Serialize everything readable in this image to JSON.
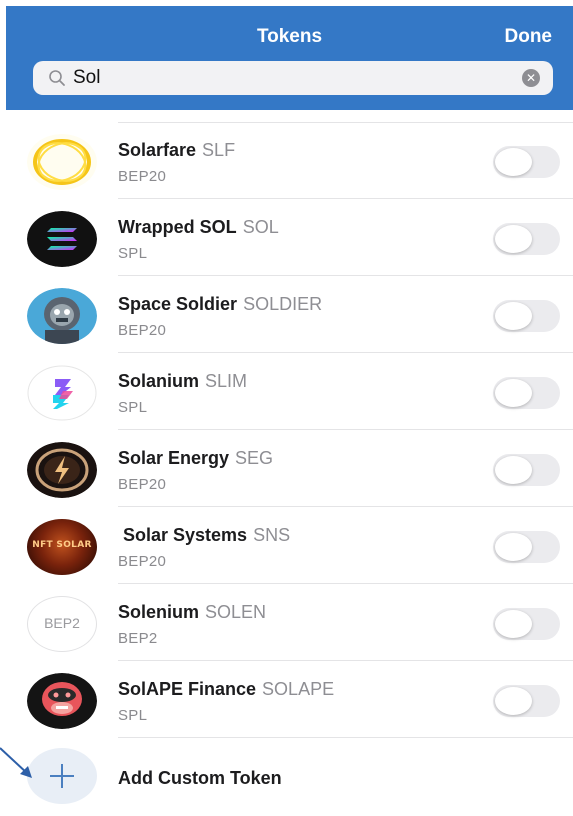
{
  "header": {
    "title": "Tokens",
    "done_label": "Done"
  },
  "search": {
    "value": "Sol"
  },
  "tokens": [
    {
      "name": "Solarfare",
      "symbol": "SLF",
      "network": "BEP20",
      "icon": "solarfare-logo",
      "enabled": false
    },
    {
      "name": "Wrapped SOL",
      "symbol": "SOL",
      "network": "SPL",
      "icon": "solana-logo",
      "enabled": false
    },
    {
      "name": "Space Soldier",
      "symbol": "SOLDIER",
      "network": "BEP20",
      "icon": "space-soldier-logo",
      "enabled": false
    },
    {
      "name": "Solanium",
      "symbol": "SLIM",
      "network": "SPL",
      "icon": "solanium-logo",
      "enabled": false
    },
    {
      "name": "Solar Energy",
      "symbol": "SEG",
      "network": "BEP20",
      "icon": "solar-energy-logo",
      "enabled": false
    },
    {
      "name": "Solar Systems",
      "symbol": "SNS",
      "network": "BEP20",
      "icon": "solar-systems-logo",
      "logo_text": "NFT SOLAR",
      "enabled": false
    },
    {
      "name": "Solenium",
      "symbol": "SOLEN",
      "network": "BEP2",
      "icon": "bep2-placeholder-logo",
      "logo_text": "BEP2",
      "enabled": false
    },
    {
      "name": "SolAPE Finance",
      "symbol": "SOLAPE",
      "network": "SPL",
      "icon": "solape-logo",
      "enabled": false
    }
  ],
  "add_custom": {
    "label": "Add Custom Token",
    "icon": "plus-icon"
  },
  "colors": {
    "header_bg": "#3478c6",
    "toggle_off": "#ebebee",
    "arrow": "#2d5fa8"
  }
}
